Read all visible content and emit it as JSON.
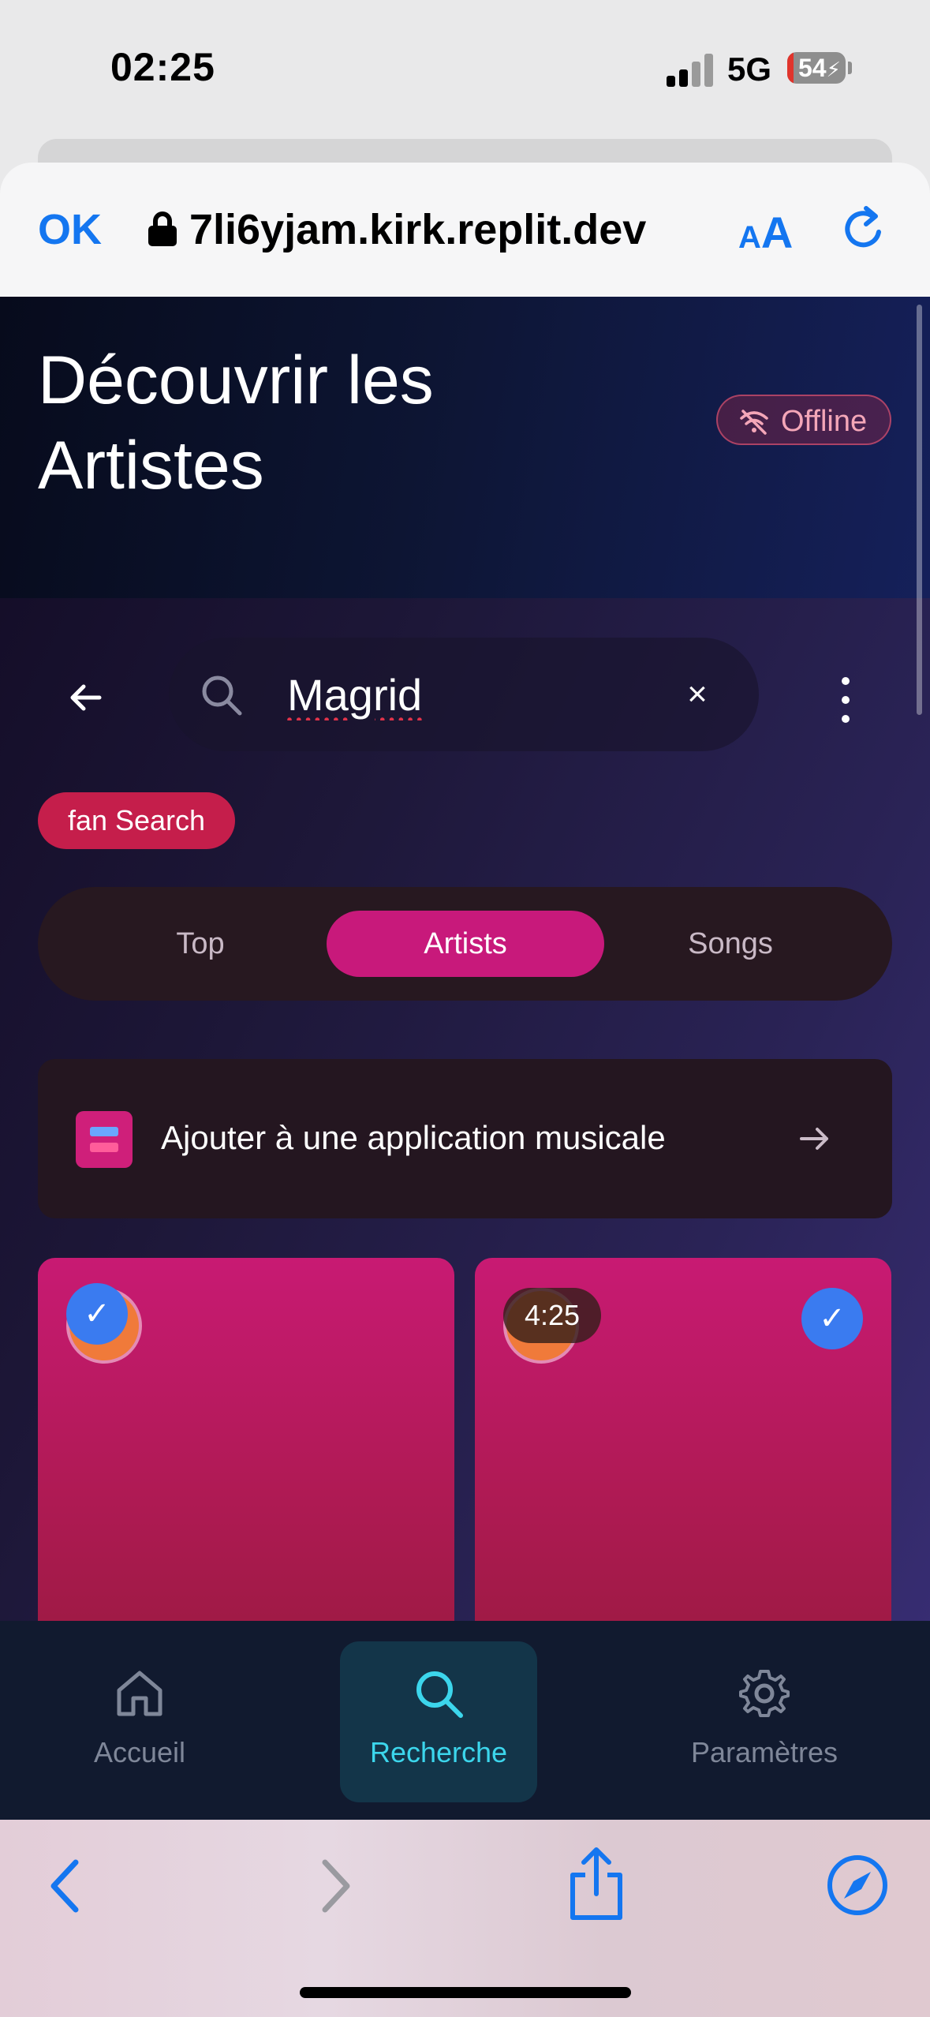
{
  "status": {
    "time": "02:25",
    "network": "5G",
    "battery": "54"
  },
  "browser": {
    "done_label": "OK",
    "url": "7li6yjam.kirk.replit.dev",
    "text_size_small": "A",
    "text_size_large": "A",
    "accent_color": "#1476f0"
  },
  "header": {
    "title": "Découvrir les Artistes",
    "offline_label": "Offline"
  },
  "search": {
    "value": "Magrid",
    "clear_label": "×"
  },
  "chip": {
    "label": "fan Search"
  },
  "tabs": [
    {
      "label": "Top",
      "active": false
    },
    {
      "label": "Artists",
      "active": true
    },
    {
      "label": "Songs",
      "active": false
    }
  ],
  "add_card": {
    "label": "Ajouter à une application musicale"
  },
  "cards": [
    {
      "checked": true,
      "check_label": "✓"
    },
    {
      "checked": true,
      "check_label": "✓",
      "duration": "4:25"
    }
  ],
  "bottom_nav": [
    {
      "label": "Accueil",
      "icon": "home-icon",
      "active": false
    },
    {
      "label": "Recherche",
      "icon": "search-icon",
      "active": true
    },
    {
      "label": "Paramètres",
      "icon": "gear-icon",
      "active": false
    }
  ],
  "colors": {
    "primary_pink": "#c8197b",
    "active_nav": "#3cd6ec",
    "check_blue": "#3a7bf0"
  }
}
